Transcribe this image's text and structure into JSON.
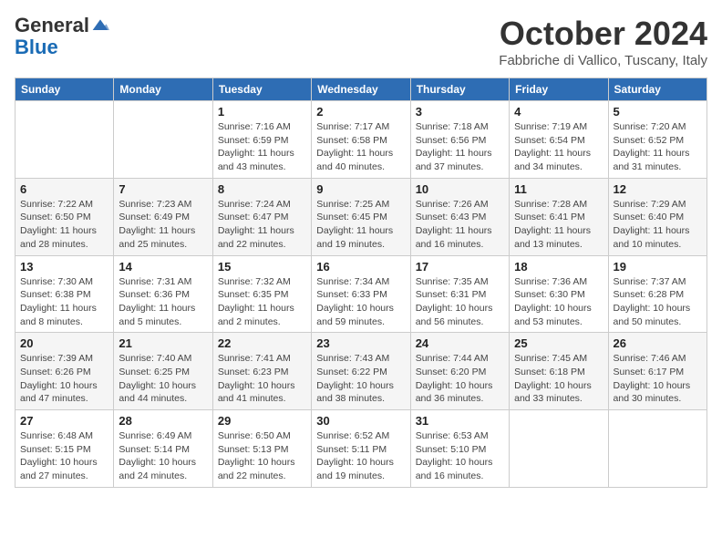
{
  "header": {
    "logo_general": "General",
    "logo_blue": "Blue",
    "month_title": "October 2024",
    "location": "Fabbriche di Vallico, Tuscany, Italy"
  },
  "columns": [
    "Sunday",
    "Monday",
    "Tuesday",
    "Wednesday",
    "Thursday",
    "Friday",
    "Saturday"
  ],
  "weeks": [
    [
      {
        "day": "",
        "info": ""
      },
      {
        "day": "",
        "info": ""
      },
      {
        "day": "1",
        "info": "Sunrise: 7:16 AM\nSunset: 6:59 PM\nDaylight: 11 hours and 43 minutes."
      },
      {
        "day": "2",
        "info": "Sunrise: 7:17 AM\nSunset: 6:58 PM\nDaylight: 11 hours and 40 minutes."
      },
      {
        "day": "3",
        "info": "Sunrise: 7:18 AM\nSunset: 6:56 PM\nDaylight: 11 hours and 37 minutes."
      },
      {
        "day": "4",
        "info": "Sunrise: 7:19 AM\nSunset: 6:54 PM\nDaylight: 11 hours and 34 minutes."
      },
      {
        "day": "5",
        "info": "Sunrise: 7:20 AM\nSunset: 6:52 PM\nDaylight: 11 hours and 31 minutes."
      }
    ],
    [
      {
        "day": "6",
        "info": "Sunrise: 7:22 AM\nSunset: 6:50 PM\nDaylight: 11 hours and 28 minutes."
      },
      {
        "day": "7",
        "info": "Sunrise: 7:23 AM\nSunset: 6:49 PM\nDaylight: 11 hours and 25 minutes."
      },
      {
        "day": "8",
        "info": "Sunrise: 7:24 AM\nSunset: 6:47 PM\nDaylight: 11 hours and 22 minutes."
      },
      {
        "day": "9",
        "info": "Sunrise: 7:25 AM\nSunset: 6:45 PM\nDaylight: 11 hours and 19 minutes."
      },
      {
        "day": "10",
        "info": "Sunrise: 7:26 AM\nSunset: 6:43 PM\nDaylight: 11 hours and 16 minutes."
      },
      {
        "day": "11",
        "info": "Sunrise: 7:28 AM\nSunset: 6:41 PM\nDaylight: 11 hours and 13 minutes."
      },
      {
        "day": "12",
        "info": "Sunrise: 7:29 AM\nSunset: 6:40 PM\nDaylight: 11 hours and 10 minutes."
      }
    ],
    [
      {
        "day": "13",
        "info": "Sunrise: 7:30 AM\nSunset: 6:38 PM\nDaylight: 11 hours and 8 minutes."
      },
      {
        "day": "14",
        "info": "Sunrise: 7:31 AM\nSunset: 6:36 PM\nDaylight: 11 hours and 5 minutes."
      },
      {
        "day": "15",
        "info": "Sunrise: 7:32 AM\nSunset: 6:35 PM\nDaylight: 11 hours and 2 minutes."
      },
      {
        "day": "16",
        "info": "Sunrise: 7:34 AM\nSunset: 6:33 PM\nDaylight: 10 hours and 59 minutes."
      },
      {
        "day": "17",
        "info": "Sunrise: 7:35 AM\nSunset: 6:31 PM\nDaylight: 10 hours and 56 minutes."
      },
      {
        "day": "18",
        "info": "Sunrise: 7:36 AM\nSunset: 6:30 PM\nDaylight: 10 hours and 53 minutes."
      },
      {
        "day": "19",
        "info": "Sunrise: 7:37 AM\nSunset: 6:28 PM\nDaylight: 10 hours and 50 minutes."
      }
    ],
    [
      {
        "day": "20",
        "info": "Sunrise: 7:39 AM\nSunset: 6:26 PM\nDaylight: 10 hours and 47 minutes."
      },
      {
        "day": "21",
        "info": "Sunrise: 7:40 AM\nSunset: 6:25 PM\nDaylight: 10 hours and 44 minutes."
      },
      {
        "day": "22",
        "info": "Sunrise: 7:41 AM\nSunset: 6:23 PM\nDaylight: 10 hours and 41 minutes."
      },
      {
        "day": "23",
        "info": "Sunrise: 7:43 AM\nSunset: 6:22 PM\nDaylight: 10 hours and 38 minutes."
      },
      {
        "day": "24",
        "info": "Sunrise: 7:44 AM\nSunset: 6:20 PM\nDaylight: 10 hours and 36 minutes."
      },
      {
        "day": "25",
        "info": "Sunrise: 7:45 AM\nSunset: 6:18 PM\nDaylight: 10 hours and 33 minutes."
      },
      {
        "day": "26",
        "info": "Sunrise: 7:46 AM\nSunset: 6:17 PM\nDaylight: 10 hours and 30 minutes."
      }
    ],
    [
      {
        "day": "27",
        "info": "Sunrise: 6:48 AM\nSunset: 5:15 PM\nDaylight: 10 hours and 27 minutes."
      },
      {
        "day": "28",
        "info": "Sunrise: 6:49 AM\nSunset: 5:14 PM\nDaylight: 10 hours and 24 minutes."
      },
      {
        "day": "29",
        "info": "Sunrise: 6:50 AM\nSunset: 5:13 PM\nDaylight: 10 hours and 22 minutes."
      },
      {
        "day": "30",
        "info": "Sunrise: 6:52 AM\nSunset: 5:11 PM\nDaylight: 10 hours and 19 minutes."
      },
      {
        "day": "31",
        "info": "Sunrise: 6:53 AM\nSunset: 5:10 PM\nDaylight: 10 hours and 16 minutes."
      },
      {
        "day": "",
        "info": ""
      },
      {
        "day": "",
        "info": ""
      }
    ]
  ]
}
